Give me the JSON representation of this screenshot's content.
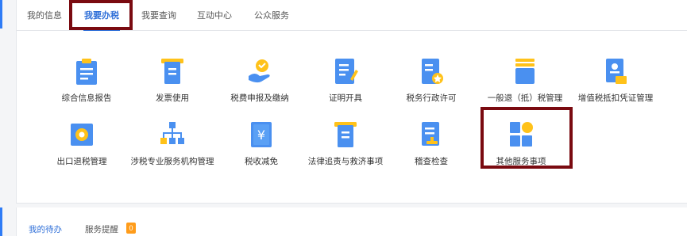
{
  "tabs": [
    {
      "label": "我的信息"
    },
    {
      "label": "我要办税"
    },
    {
      "label": "我要查询"
    },
    {
      "label": "互动中心"
    },
    {
      "label": "公众服务"
    }
  ],
  "services": [
    {
      "label": "综合信息报告",
      "icon": "clipboard-report-icon"
    },
    {
      "label": "发票使用",
      "icon": "invoice-icon"
    },
    {
      "label": "税费申报及缴纳",
      "icon": "declare-pay-icon"
    },
    {
      "label": "证明开具",
      "icon": "certificate-icon"
    },
    {
      "label": "税务行政许可",
      "icon": "admin-permit-icon"
    },
    {
      "label": "一般退（抵）税管理",
      "icon": "tax-refund-icon"
    },
    {
      "label": "增值税抵扣凭证管理",
      "icon": "vat-voucher-icon"
    },
    {
      "label": "出口退税管理",
      "icon": "export-refund-icon"
    },
    {
      "label": "涉税专业服务机构管理",
      "icon": "org-structure-icon"
    },
    {
      "label": "税收减免",
      "icon": "tax-relief-icon"
    },
    {
      "label": "法律追责与救济事项",
      "icon": "legal-icon"
    },
    {
      "label": "稽查检查",
      "icon": "inspection-icon"
    },
    {
      "label": "其他服务事项",
      "icon": "other-services-icon"
    }
  ],
  "bottom_tabs": [
    {
      "label": "我的待办"
    },
    {
      "label": "服务提醒",
      "badge": "0"
    }
  ],
  "colors": {
    "accent_blue": "#2f6fd8",
    "icon_blue": "#4a90f0",
    "icon_yellow": "#ffc21a",
    "highlight_box": "#7a0a10",
    "badge": "#ff9c1a"
  }
}
